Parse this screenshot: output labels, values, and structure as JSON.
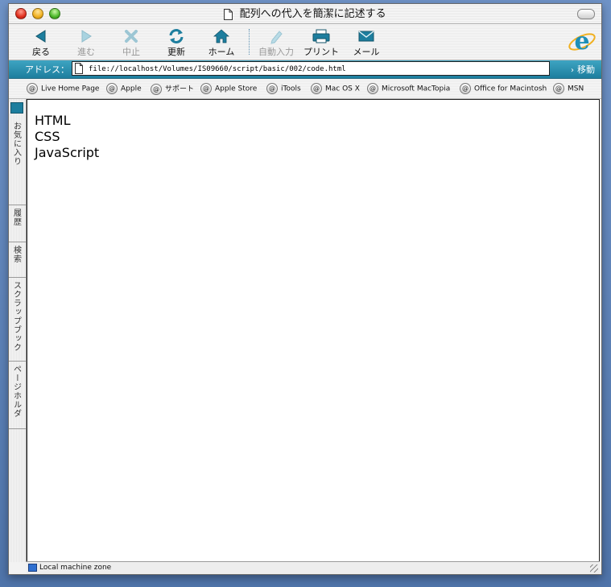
{
  "window": {
    "title": "配列への代入を簡潔に記述する"
  },
  "toolbar": {
    "back": "戻る",
    "forward": "進む",
    "stop": "中止",
    "refresh": "更新",
    "home": "ホーム",
    "autofill": "自動入力",
    "print": "プリント",
    "mail": "メール"
  },
  "address": {
    "label": "アドレス：",
    "url": "file://localhost/Volumes/IS09660/script/basic/002/code.html",
    "go_label": "移動"
  },
  "favorites": [
    "Live Home Page",
    "Apple",
    "サポート",
    "Apple Store",
    "iTools",
    "Mac OS X",
    "Microsoft MacTopia",
    "Office for Macintosh",
    "MSN"
  ],
  "side_tabs": [
    "お気に入り",
    "履歴",
    "検索",
    "スクラップブック",
    "ページホルダ"
  ],
  "content": {
    "lines": [
      "HTML",
      "CSS",
      "JavaScript"
    ]
  },
  "status": {
    "text": "Local machine zone"
  },
  "colors": {
    "accent": "#1d7e9e",
    "desktop": "#5b7fb3"
  }
}
